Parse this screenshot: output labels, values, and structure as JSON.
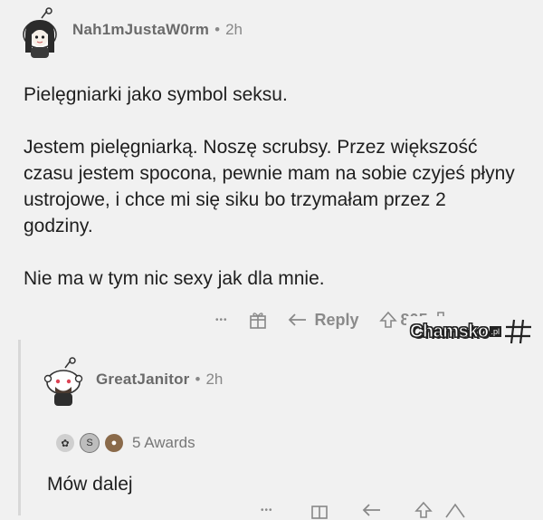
{
  "post": {
    "username": "Nah1mJustaW0rm",
    "separator": "•",
    "time": "2h",
    "paragraphs": [
      "Pielęgniarki jako symbol seksu.",
      "Jestem pielęgniarką. Noszę scrubsy. Przez większość czasu jestem spocona, pewnie mam na sobie czyjeś płyny ustrojowe, i chce mi się siku bo trzymałam przez 2 godziny.",
      "Nie ma w tym nic sexy jak dla mnie."
    ],
    "actions": {
      "more": "•••",
      "reply_label": "Reply",
      "vote_count": "805"
    }
  },
  "reply": {
    "username": "GreatJanitor",
    "separator": "•",
    "time": "2h",
    "awards_label": "5 Awards",
    "text": "Mów dalej",
    "more": "•••"
  },
  "watermark": {
    "text": "Chamsko",
    "suffix": ".pl"
  },
  "colors": {
    "background": "#f1f1f1",
    "text": "#1e1e1e",
    "meta": "#888888"
  },
  "icons": [
    "snoo-avatar-icon",
    "award-icon",
    "reply-arrow-icon",
    "upvote-icon",
    "downvote-icon",
    "more-dots-icon"
  ]
}
